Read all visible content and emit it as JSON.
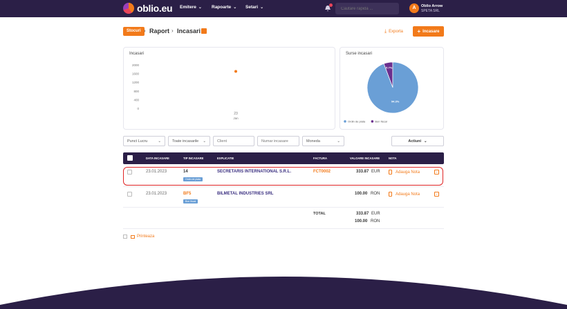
{
  "header": {
    "logo_text": "oblio.eu",
    "nav": [
      "Emitere",
      "Rapoarte",
      "Setari"
    ],
    "search_placeholder": "Cautare rapida ...",
    "user_initial": "A",
    "user_name": "Oblio Arrow",
    "user_company": "SPETA SRL"
  },
  "breadcrumb": {
    "badge": "Stocuri",
    "items": [
      "Raport",
      "Incasari"
    ]
  },
  "actions": {
    "export": "Exporta",
    "add": "Incasare"
  },
  "line_chart": {
    "title": "Incasari",
    "y_ticks": [
      "2000",
      "1600",
      "1200",
      "800",
      "400",
      "0"
    ]
  },
  "pie": {
    "title": "Surse incasari"
  },
  "chart_data": [
    {
      "type": "scatter",
      "title": "Incasari",
      "x": [
        "23 Jan"
      ],
      "x_tick_day": "23",
      "x_tick_month": "Jan",
      "y": [
        1700
      ],
      "ylim": [
        0,
        2000
      ],
      "color": "#f27a1a"
    },
    {
      "type": "pie",
      "title": "Surse incasari",
      "slices": [
        {
          "label": "Ordin de plata",
          "value": 94.3,
          "label_text": "94.3%",
          "color": "#6a9fd6"
        },
        {
          "label": "Bon fiscal",
          "value": 5.7,
          "label_text": "5.7%",
          "color": "#6b2f8e"
        }
      ]
    }
  ],
  "filters": {
    "punct_lucru": "Punct Lucru",
    "tip": "Toate incasarile",
    "client": "Client",
    "numar": "Numar incasare",
    "moneda": "Moneda",
    "actiuni": "Actiuni"
  },
  "table": {
    "headers": [
      "DATA INCASARE",
      "TIP INCASARE",
      "EXPLICATIE",
      "FACTURA",
      "VALOARE INCASARE",
      "NOTA"
    ],
    "rows": [
      {
        "date": "23.01.2023",
        "tip": "14",
        "tag": "Ordin de plata",
        "client": "SECRETARIS INTERNATIONAL S.R.L.",
        "factura": "FCT0002",
        "amount": "333.87",
        "currency": "EUR",
        "nota": "Adauga Nota"
      },
      {
        "date": "23.01.2023",
        "tip": "BF5",
        "tag": "Bon fiscal",
        "client": "BILMETAL INDUSTRIES SRL",
        "factura": "",
        "amount": "100.00",
        "currency": "RON",
        "nota": "Adauga Nota"
      }
    ],
    "total_label": "TOTAL",
    "totals": [
      {
        "amount": "333.87",
        "currency": "EUR"
      },
      {
        "amount": "100.00",
        "currency": "RON"
      }
    ]
  },
  "print_label": "Printeaza",
  "colors": {
    "brand_dark": "#2b1f47",
    "accent": "#f27a1a",
    "highlight": "#e02424"
  }
}
